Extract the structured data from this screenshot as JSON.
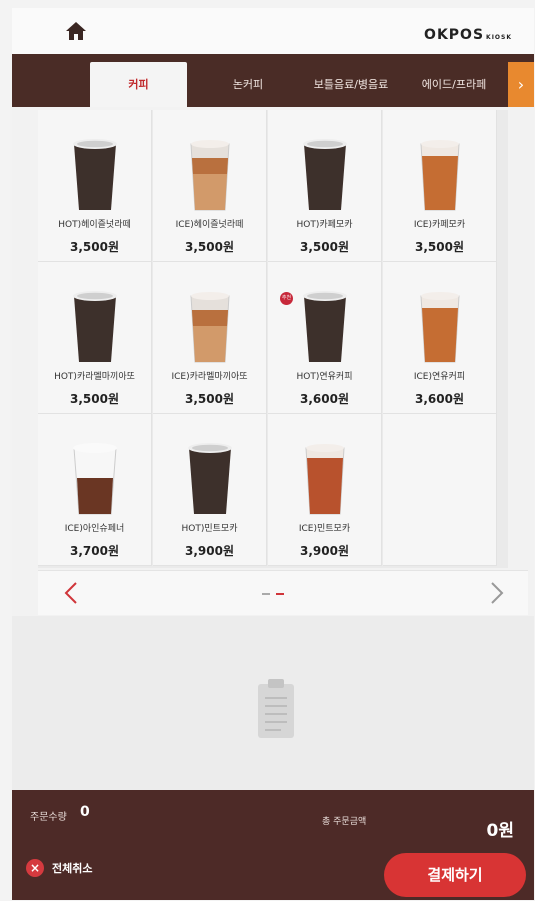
{
  "header": {
    "home_icon": "home-icon",
    "brand": "OKPOS",
    "brand_sub": "KIOSK"
  },
  "tabs": [
    {
      "label": "커피",
      "active": true
    },
    {
      "label": "논커피",
      "active": false
    },
    {
      "label": "보틀음료/병음료",
      "active": false
    },
    {
      "label": "에이드/프라페",
      "active": false
    }
  ],
  "tabs_next_icon": "chevron-right-icon",
  "products": [
    {
      "name": "HOT)헤이즐넛라떼",
      "price": "3,500원",
      "style": "hot"
    },
    {
      "name": "ICE)헤이즐넛라떼",
      "price": "3,500원",
      "style": "ice-latte"
    },
    {
      "name": "HOT)카페모카",
      "price": "3,500원",
      "style": "hot"
    },
    {
      "name": "ICE)카페모카",
      "price": "3,500원",
      "style": "ice-mocha"
    },
    {
      "name": "HOT)카라멜마끼아또",
      "price": "3,500원",
      "style": "hot"
    },
    {
      "name": "ICE)카라멜마끼아또",
      "price": "3,500원",
      "style": "ice-latte"
    },
    {
      "name": "HOT)연유커피",
      "price": "3,600원",
      "style": "hot",
      "badge": "추천"
    },
    {
      "name": "ICE)연유커피",
      "price": "3,600원",
      "style": "ice-mocha"
    },
    {
      "name": "ICE)아인슈페너",
      "price": "3,700원",
      "style": "einspanner"
    },
    {
      "name": "HOT)민트모카",
      "price": "3,900원",
      "style": "hot"
    },
    {
      "name": "ICE)민트모카",
      "price": "3,900원",
      "style": "ice-mint"
    }
  ],
  "pager": {
    "prev_icon": "chevron-left-icon",
    "next_icon": "chevron-right-icon",
    "pages": 2,
    "current": 2
  },
  "cart": {
    "empty_icon": "clipboard-icon"
  },
  "footer": {
    "qty_label": "주문수량",
    "qty_value": "0",
    "total_label": "총 주문금액",
    "total_value": "0원",
    "cancel_label": "전체취소",
    "pay_label": "결제하기"
  },
  "colors": {
    "tab_bar": "#4a2c26",
    "accent_red": "#d83434",
    "tab_next": "#e8892f"
  }
}
